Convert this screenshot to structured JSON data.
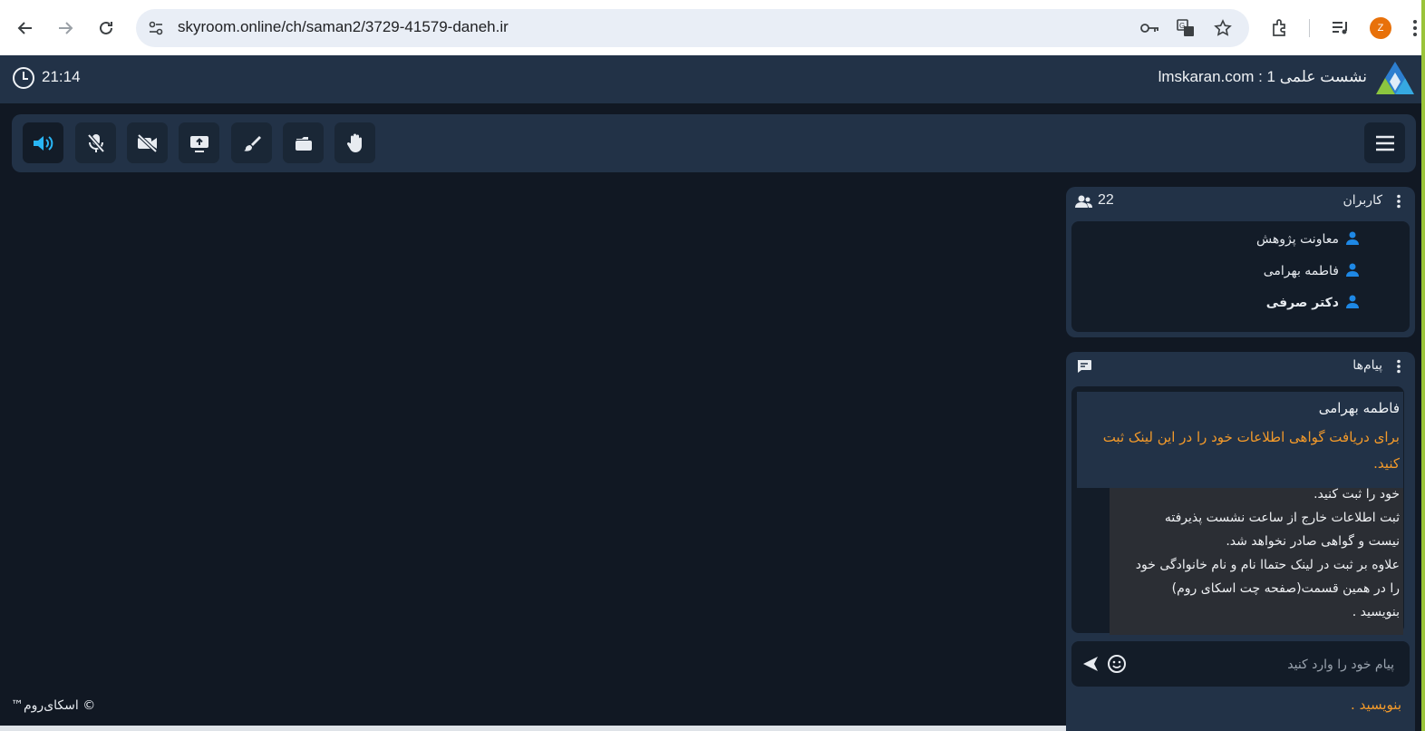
{
  "browser": {
    "url": "skyroom.online/ch/saman2/3729-41579-daneh.ir",
    "profile_initial": "Z"
  },
  "header": {
    "clock": "21:14",
    "room_title": "lmskaran.com : نشست علمی 1"
  },
  "toolbar": {
    "buttons": [
      "speaker-icon",
      "mic-off-icon",
      "camera-off-icon",
      "screen-share-icon",
      "brush-icon",
      "folder-icon",
      "hand-icon"
    ],
    "active_color": "#29b6f6"
  },
  "users": {
    "title": "کاربران",
    "count": "22",
    "items": [
      {
        "name": "معاونت پژوهش",
        "bold": false
      },
      {
        "name": "فاطمه بهرامی",
        "bold": false
      },
      {
        "name": "دکتر صرفی",
        "bold": true
      }
    ]
  },
  "messages": {
    "title": "پیام‌ها",
    "items": [
      {
        "sender": "فاطمه بهرامی",
        "text": "برای دریافت گواهی اطلاعات خود را در این لینک ثبت کنید."
      }
    ],
    "tooltip_lines": [
      "خود را ثبت کنید.",
      "ثبت اطلاعات خارج از ساعت نشست پذیرفته",
      "نیست و گواهی صادر نخواهد شد.",
      "علاوه بر ثبت در لینک حتماا نام و نام خانوادگی خود",
      "را در همین قسمت(صفحه چت اسکای روم)",
      "بنویسید ."
    ],
    "below_text": "بنویسید .",
    "input_placeholder": "پیام خود را وارد کنید"
  },
  "footer": {
    "brand": "™اسکای‌روم ©"
  },
  "colors": {
    "accent": "#1e88e5",
    "highlight": "#f39a2a",
    "panel": "#223247",
    "background": "#111823"
  }
}
